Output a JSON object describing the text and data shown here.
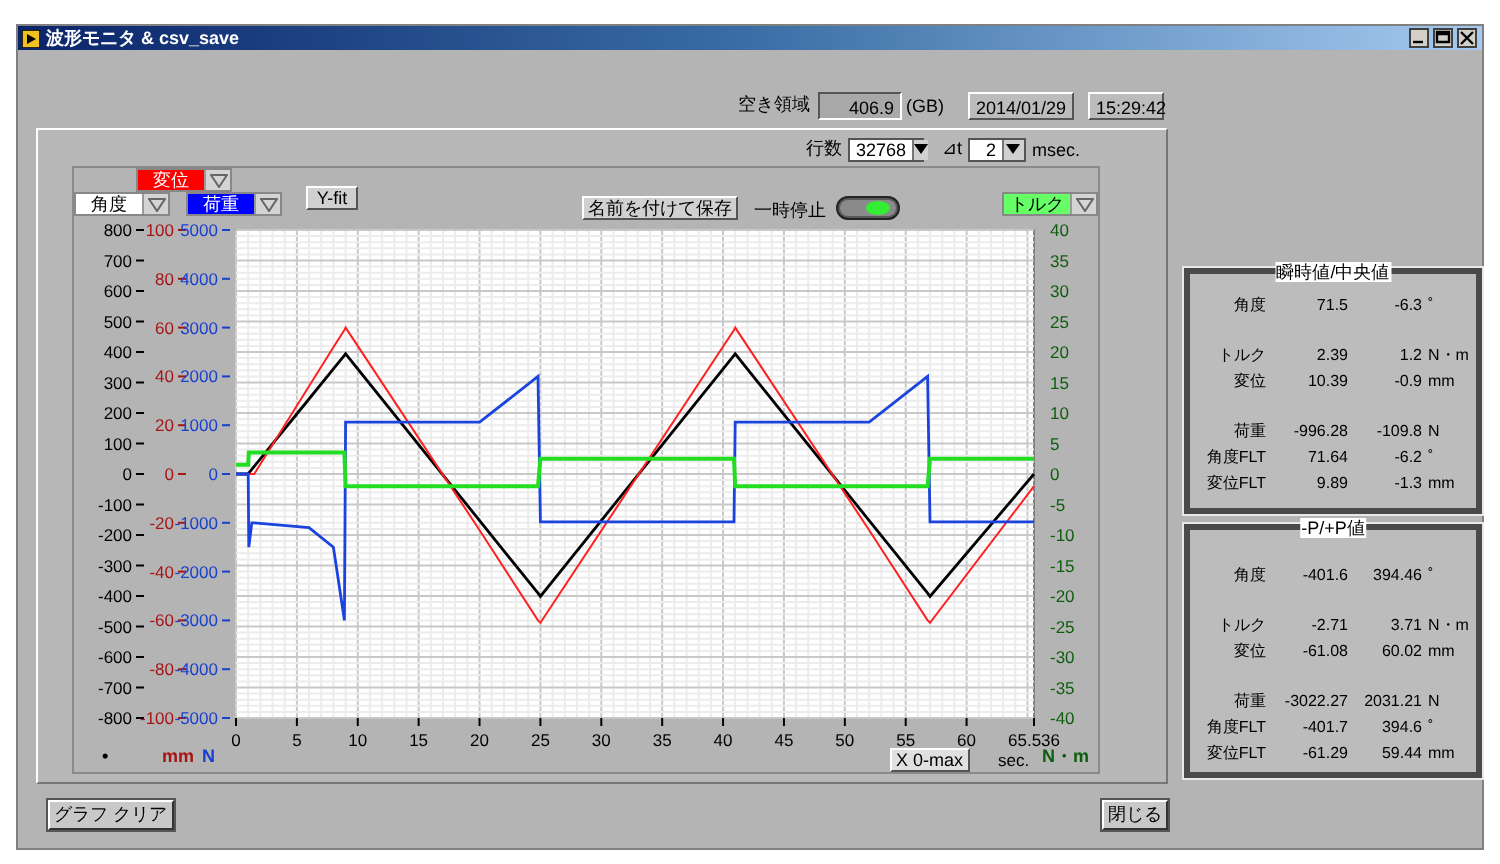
{
  "window": {
    "title": "波形モニタ & csv_save"
  },
  "storage": {
    "label": "空き領域",
    "value": "406.9",
    "unit": "(GB)",
    "date": "2014/01/29",
    "time": "15:29:42"
  },
  "settings": {
    "rows_label": "行数",
    "rows_value": "32768",
    "dt_label": "⊿t",
    "dt_value": "2",
    "dt_unit": "msec."
  },
  "graph": {
    "yfit_button": "Y-fit",
    "save_button": "名前を付けて保存",
    "pause": {
      "label": "一時停止",
      "on": true
    },
    "xfit_button": "X 0-max",
    "charts": [
      {
        "chart_data": {
          "type": "line",
          "xlabel": "sec.",
          "ylabel": "•",
          "grid": true,
          "x": [
            0,
            1,
            1.05,
            1.3,
            1.5,
            6,
            8,
            8.9,
            9,
            20,
            24.8,
            25,
            40.9,
            41,
            52,
            56.8,
            57,
            65.536
          ],
          "xlim": [
            0,
            65.536
          ],
          "xticks": [
            0,
            5,
            10,
            15,
            20,
            25,
            30,
            35,
            40,
            45,
            50,
            55,
            60,
            65.536
          ],
          "ylim": [
            -800,
            800
          ],
          "yticks": [
            800,
            700,
            600,
            500,
            400,
            300,
            200,
            100,
            0,
            -100,
            -200,
            -300,
            -400,
            -500,
            -600,
            -700,
            -800
          ],
          "series": [
            {
              "name": "角度",
              "color": "#000000",
              "values": [
                0,
                0,
                3,
                15,
                25,
                246,
                345,
                389,
                394,
                -153,
                -391,
                -401,
                389,
                394,
                -153,
                -391,
                -401,
                0
              ]
            }
          ]
        }
      },
      {
        "chart_data": {
          "type": "line",
          "ylabel": "mm",
          "x": [
            0,
            1,
            1.05,
            1.3,
            1.5,
            6,
            8,
            8.9,
            9,
            20,
            24.8,
            25,
            40.9,
            41,
            52,
            56.8,
            57,
            65.536
          ],
          "xlim": [
            0,
            65.536
          ],
          "ylim": [
            -100,
            100
          ],
          "yticks": [
            100,
            80,
            60,
            40,
            20,
            0,
            -20,
            -40,
            -60,
            -80,
            -100
          ],
          "series": [
            {
              "name": "変位",
              "color": "#ff2020",
              "values": [
                0,
                0,
                0,
                0,
                0,
                36,
                52,
                59,
                60,
                -23,
                -60,
                -61,
                59,
                60,
                -23,
                -60,
                -61,
                -5
              ]
            }
          ]
        }
      },
      {
        "chart_data": {
          "type": "line",
          "ylabel": "N",
          "x": [
            0,
            1,
            1.05,
            1.3,
            1.5,
            6,
            8,
            8.9,
            9,
            20,
            24.8,
            25,
            40.9,
            41,
            52,
            56.8,
            57,
            65.536
          ],
          "xlim": [
            0,
            65.536
          ],
          "ylim": [
            -5000,
            5000
          ],
          "yticks": [
            5000,
            4000,
            3000,
            2000,
            1000,
            0,
            -1000,
            -2000,
            -3000,
            -4000,
            -5000
          ],
          "series": [
            {
              "name": "荷重",
              "color": "#1a44dd",
              "values": [
                0,
                0,
                -1500,
                -1000,
                -1000,
                -1100,
                -1500,
                -3000,
                1060,
                1060,
                2000,
                -980,
                -980,
                1060,
                1060,
                2000,
                -980,
                -980
              ]
            }
          ]
        }
      },
      {
        "chart_data": {
          "type": "line",
          "ylabel": "N・m",
          "x": [
            0,
            1,
            1.05,
            1.3,
            1.5,
            6,
            8,
            8.9,
            9,
            20,
            24.8,
            25,
            40.9,
            41,
            52,
            56.8,
            57,
            65.536
          ],
          "xlim": [
            0,
            65.536
          ],
          "ylim": [
            -40,
            40
          ],
          "yticks": [
            40,
            35,
            30,
            25,
            20,
            15,
            10,
            5,
            0,
            -5,
            -10,
            -15,
            -20,
            -25,
            -30,
            -35,
            -40
          ],
          "series": [
            {
              "name": "トルク",
              "color": "#22dd22",
              "values": [
                1.5,
                1.5,
                3.5,
                3.5,
                3.5,
                3.5,
                3.5,
                3.5,
                -2,
                -2,
                -2,
                2.5,
                2.5,
                -2,
                -2,
                -2,
                2.5,
                2.5
              ]
            }
          ]
        }
      }
    ]
  },
  "panels": [
    {
      "title": "瞬時値/中央値",
      "groups": [
        {
          "rows": [
            {
              "label": "角度",
              "value_1": "71.5",
              "value_2": "-6.3",
              "unit": "˚"
            }
          ]
        },
        {
          "rows": [
            {
              "label": "トルク",
              "value_1": "2.39",
              "value_2": "1.2",
              "unit": "N・m"
            },
            {
              "label": "変位",
              "value_1": "10.39",
              "value_2": "-0.9",
              "unit": "mm"
            }
          ]
        },
        {
          "rows": [
            {
              "label": "荷重",
              "value_1": "-996.28",
              "value_2": "-109.8",
              "unit": "N"
            },
            {
              "label": "角度FLT",
              "value_1": "71.64",
              "value_2": "-6.2",
              "unit": "˚"
            },
            {
              "label": "変位FLT",
              "value_1": "9.89",
              "value_2": "-1.3",
              "unit": "mm"
            }
          ]
        }
      ]
    },
    {
      "title": "-P/+P値",
      "groups": [
        {
          "rows": [
            {
              "label": "角度",
              "value_1": "-401.6",
              "value_2": "394.46",
              "unit": "˚"
            }
          ]
        },
        {
          "rows": [
            {
              "label": "トルク",
              "value_1": "-2.71",
              "value_2": "3.71",
              "unit": "N・m"
            },
            {
              "label": "変位",
              "value_1": "-61.08",
              "value_2": "60.02",
              "unit": "mm"
            }
          ]
        },
        {
          "rows": [
            {
              "label": "荷重",
              "value_1": "-3022.27",
              "value_2": "2031.21",
              "unit": "N"
            },
            {
              "label": "角度FLT",
              "value_1": "-401.7",
              "value_2": "394.6",
              "unit": "˚"
            },
            {
              "label": "変位FLT",
              "value_1": "-61.29",
              "value_2": "59.44",
              "unit": "mm"
            }
          ]
        }
      ]
    }
  ],
  "footer_buttons": [
    "グラフ クリア",
    "閉じる"
  ]
}
